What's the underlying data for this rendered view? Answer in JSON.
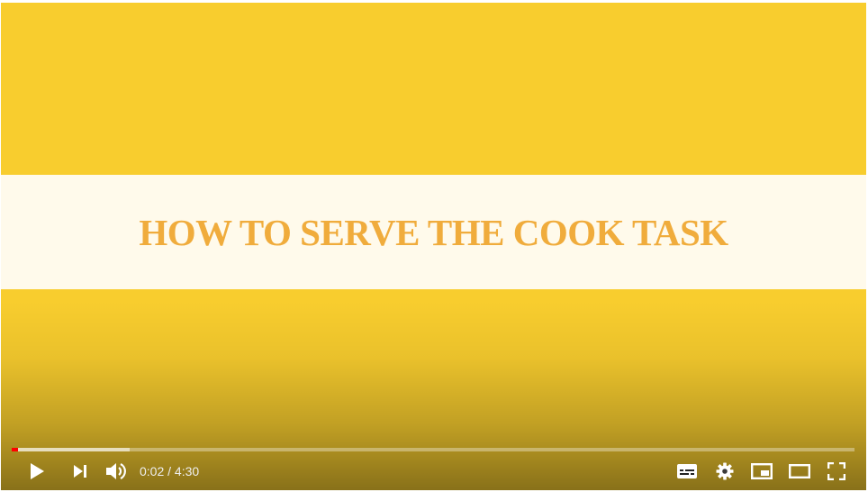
{
  "video": {
    "title_card": "HOW TO SERVE THE COOK TASK",
    "current_time": "0:02",
    "separator": "/",
    "duration": "4:30",
    "progress_played": 0.0074,
    "progress_buffered": 0.14
  },
  "colors": {
    "background": "#f8cd2e",
    "banner": "#fffaeb",
    "title_text": "#f0ac3c",
    "progress_played": "#ff0000"
  },
  "controls": {
    "left": [
      "play-icon",
      "next-icon",
      "volume-icon"
    ],
    "right": [
      "subtitles-icon",
      "settings-gear-icon",
      "miniplayer-icon",
      "theater-mode-icon",
      "fullscreen-icon"
    ]
  }
}
